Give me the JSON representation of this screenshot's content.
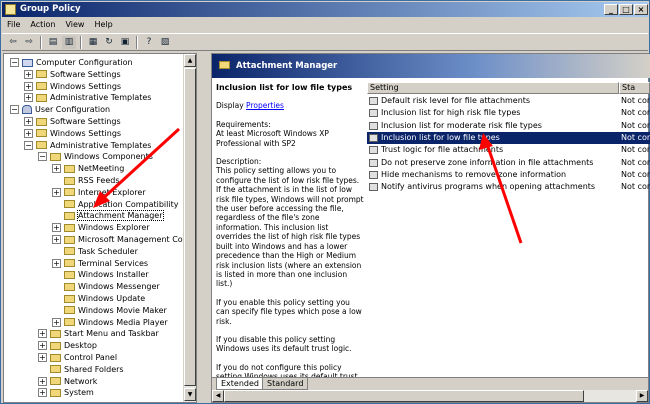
{
  "window": {
    "title": "Group Policy"
  },
  "menu": [
    "File",
    "Action",
    "View",
    "Help"
  ],
  "tree": [
    {
      "label": "Computer Configuration",
      "icon": "monitor-icon",
      "indent": 0,
      "exp": "-"
    },
    {
      "label": "Software Settings",
      "icon": "folder-icon",
      "indent": 1,
      "exp": "+"
    },
    {
      "label": "Windows Settings",
      "icon": "folder-icon",
      "indent": 1,
      "exp": "+"
    },
    {
      "label": "Administrative Templates",
      "icon": "folder-icon",
      "indent": 1,
      "exp": "+"
    },
    {
      "label": "User Configuration",
      "icon": "user-icon",
      "indent": 0,
      "exp": "-"
    },
    {
      "label": "Software Settings",
      "icon": "folder-icon",
      "indent": 1,
      "exp": "+"
    },
    {
      "label": "Windows Settings",
      "icon": "folder-icon",
      "indent": 1,
      "exp": "+"
    },
    {
      "label": "Administrative Templates",
      "icon": "folder-icon",
      "indent": 1,
      "exp": "-"
    },
    {
      "label": "Windows Components",
      "icon": "folder-icon",
      "indent": 2,
      "exp": "-"
    },
    {
      "label": "NetMeeting",
      "icon": "folder-icon",
      "indent": 3,
      "exp": "+"
    },
    {
      "label": "RSS Feeds",
      "icon": "folder-icon",
      "indent": 3,
      "exp": ""
    },
    {
      "label": "Internet Explorer",
      "icon": "folder-icon",
      "indent": 3,
      "exp": "+"
    },
    {
      "label": "Application Compatibility",
      "icon": "folder-icon",
      "indent": 3,
      "exp": ""
    },
    {
      "label": "Attachment Manager",
      "icon": "folder-icon",
      "indent": 3,
      "exp": "",
      "selected": true
    },
    {
      "label": "Windows Explorer",
      "icon": "folder-icon",
      "indent": 3,
      "exp": "+"
    },
    {
      "label": "Microsoft Management Console",
      "icon": "folder-icon",
      "indent": 3,
      "exp": "+"
    },
    {
      "label": "Task Scheduler",
      "icon": "folder-icon",
      "indent": 3,
      "exp": ""
    },
    {
      "label": "Terminal Services",
      "icon": "folder-icon",
      "indent": 3,
      "exp": "+"
    },
    {
      "label": "Windows Installer",
      "icon": "folder-icon",
      "indent": 3,
      "exp": ""
    },
    {
      "label": "Windows Messenger",
      "icon": "folder-icon",
      "indent": 3,
      "exp": ""
    },
    {
      "label": "Windows Update",
      "icon": "folder-icon",
      "indent": 3,
      "exp": ""
    },
    {
      "label": "Windows Movie Maker",
      "icon": "folder-icon",
      "indent": 3,
      "exp": ""
    },
    {
      "label": "Windows Media Player",
      "icon": "folder-icon",
      "indent": 3,
      "exp": "+"
    },
    {
      "label": "Start Menu and Taskbar",
      "icon": "folder-icon",
      "indent": 2,
      "exp": "+"
    },
    {
      "label": "Desktop",
      "icon": "folder-icon",
      "indent": 2,
      "exp": "+"
    },
    {
      "label": "Control Panel",
      "icon": "folder-icon",
      "indent": 2,
      "exp": "+"
    },
    {
      "label": "Shared Folders",
      "icon": "folder-icon",
      "indent": 2,
      "exp": ""
    },
    {
      "label": "Network",
      "icon": "folder-icon",
      "indent": 2,
      "exp": "+"
    },
    {
      "label": "System",
      "icon": "folder-icon",
      "indent": 2,
      "exp": "+"
    }
  ],
  "pane": {
    "title": "Attachment Manager",
    "extended": {
      "policy_title": "Inclusion list for low file types",
      "display_label": "Display",
      "properties_link": "Properties",
      "requirements": "Requirements:\nAt least Microsoft Windows XP Professional with SP2",
      "description": "Description:\nThis policy setting allows you to configure the list of low risk file types. If the attachment is in the list of low risk file types, Windows will not prompt the user before accessing the file, regardless of the file's zone information. This inclusion list overrides the list of high risk file types built into Windows and has a lower precedence than the High or Medium risk inclusion lists (where an extension is listed in more than one inclusion list.)",
      "enabled_text": "If you enable this policy setting you can specify file types which pose a low risk.",
      "disabled_text": "If you disable this policy setting Windows uses its default trust logic.",
      "not_configured_text": "If you do not configure this policy setting Windows uses its default trust logic."
    },
    "columns": [
      "Setting",
      "Sta"
    ],
    "settings": [
      {
        "name": "Default risk level for file attachments",
        "state": "Not con"
      },
      {
        "name": "Inclusion list for high risk file types",
        "state": "Not con"
      },
      {
        "name": "Inclusion list for moderate risk file types",
        "state": "Not con"
      },
      {
        "name": "Inclusion list for low file types",
        "state": "Not con",
        "selected": true
      },
      {
        "name": "Trust logic for file attachments",
        "state": "Not con"
      },
      {
        "name": "Do not preserve zone information in file attachments",
        "state": "Not con"
      },
      {
        "name": "Hide mechanisms to remove zone information",
        "state": "Not con"
      },
      {
        "name": "Notify antivirus programs when opening attachments",
        "state": "Not con"
      }
    ],
    "tabs": [
      "Extended",
      "Standard"
    ]
  },
  "colors": {
    "selection": "#0a246a",
    "annotation_arrow": "#ff0000"
  }
}
